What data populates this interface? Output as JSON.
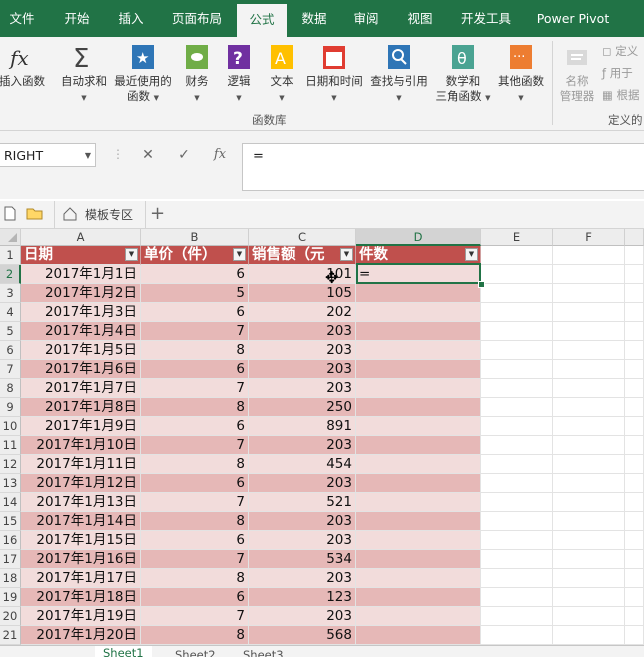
{
  "ribbon_tabs": [
    "文件",
    "开始",
    "插入",
    "页面布局",
    "公式",
    "数据",
    "审阅",
    "视图",
    "开发工具",
    "Power Pivot"
  ],
  "active_tab": "公式",
  "ribbon": {
    "buttons": {
      "insert_function": "插入函数",
      "autosum": "自动求和",
      "recent": [
        "最近使用的",
        "函数"
      ],
      "financial": "财务",
      "logical": "逻辑",
      "text": "文本",
      "datetime": "日期和时间",
      "lookup": "查找与引用",
      "math": [
        "数学和",
        "三角函数"
      ],
      "more": "其他函数",
      "name_manager": [
        "名称",
        "管理器"
      ]
    },
    "group_label": "函数库",
    "defined_names": [
      "定义",
      "用于",
      "根据"
    ],
    "defined_group_label": "定义的"
  },
  "formula_bar": {
    "name_box": "RIGHT",
    "cancel_glyph": "✕",
    "enter_glyph": "✓",
    "fx_glyph": "fx",
    "formula": "="
  },
  "file_strip": {
    "template_label": "模板专区",
    "add_glyph": "+"
  },
  "columns": [
    "A",
    "B",
    "C",
    "D",
    "E",
    "F"
  ],
  "headers": [
    "日期",
    "单价（件）",
    "销售额（元",
    "件数"
  ],
  "rows": [
    {
      "n": "1"
    },
    {
      "n": "2",
      "date": "2017年1月1日",
      "price": "6",
      "sales": "101",
      "count": "="
    },
    {
      "n": "3",
      "date": "2017年1月2日",
      "price": "5",
      "sales": "105"
    },
    {
      "n": "4",
      "date": "2017年1月3日",
      "price": "6",
      "sales": "202"
    },
    {
      "n": "5",
      "date": "2017年1月4日",
      "price": "7",
      "sales": "203"
    },
    {
      "n": "6",
      "date": "2017年1月5日",
      "price": "8",
      "sales": "203"
    },
    {
      "n": "7",
      "date": "2017年1月6日",
      "price": "6",
      "sales": "203"
    },
    {
      "n": "8",
      "date": "2017年1月7日",
      "price": "7",
      "sales": "203"
    },
    {
      "n": "9",
      "date": "2017年1月8日",
      "price": "8",
      "sales": "250"
    },
    {
      "n": "10",
      "date": "2017年1月9日",
      "price": "6",
      "sales": "891"
    },
    {
      "n": "11",
      "date": "2017年1月10日",
      "price": "7",
      "sales": "203"
    },
    {
      "n": "12",
      "date": "2017年1月11日",
      "price": "8",
      "sales": "454"
    },
    {
      "n": "13",
      "date": "2017年1月12日",
      "price": "6",
      "sales": "203"
    },
    {
      "n": "14",
      "date": "2017年1月13日",
      "price": "7",
      "sales": "521"
    },
    {
      "n": "15",
      "date": "2017年1月14日",
      "price": "8",
      "sales": "203"
    },
    {
      "n": "16",
      "date": "2017年1月15日",
      "price": "6",
      "sales": "203"
    },
    {
      "n": "17",
      "date": "2017年1月16日",
      "price": "7",
      "sales": "534"
    },
    {
      "n": "18",
      "date": "2017年1月17日",
      "price": "8",
      "sales": "203"
    },
    {
      "n": "19",
      "date": "2017年1月18日",
      "price": "6",
      "sales": "123"
    },
    {
      "n": "20",
      "date": "2017年1月19日",
      "price": "7",
      "sales": "203"
    },
    {
      "n": "21",
      "date": "2017年1月20日",
      "price": "8",
      "sales": "568"
    }
  ],
  "sheet_tabs": [
    "Sheet1",
    "Sheet2",
    "Sheet3"
  ],
  "colors": {
    "excel_green": "#217346",
    "header_fill": "#c0504d",
    "band_dark": "#e6b8b7",
    "band_light": "#f2dcdb"
  }
}
